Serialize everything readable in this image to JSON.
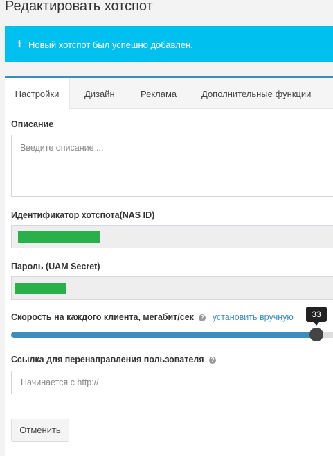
{
  "page": {
    "title": "Редактировать хотспот"
  },
  "alert": {
    "icon": "info-icon",
    "message": "Новый хотспот был успешно добавлен.",
    "color": "#00c0ef"
  },
  "tabs": [
    {
      "label": "Настройки",
      "active": true
    },
    {
      "label": "Дизайн",
      "active": false
    },
    {
      "label": "Реклама",
      "active": false
    },
    {
      "label": "Дополнительные функции",
      "active": false
    }
  ],
  "form": {
    "description": {
      "label": "Описание",
      "placeholder": "Введите описание ..."
    },
    "nas_id": {
      "label": "Идентификатор хотспота(NAS ID)",
      "value_redacted": true
    },
    "uam_secret": {
      "label": "Пароль (UAM Secret)",
      "value_redacted": true
    },
    "speed": {
      "label": "Скорость на каждого клиента, мегабит/сек",
      "help_icon": "question-circle-icon",
      "manual_link": "установить вручную",
      "value": "33",
      "fill_fraction": 0.93
    },
    "redirect_url": {
      "label": "Ссылка для перенаправления пользователя",
      "help_icon": "question-circle-icon",
      "placeholder": "Начинается с http://"
    }
  },
  "actions": {
    "cancel_label": "Отменить"
  },
  "colors": {
    "accent": "#3c8dbc",
    "redaction": "#28b04a"
  }
}
